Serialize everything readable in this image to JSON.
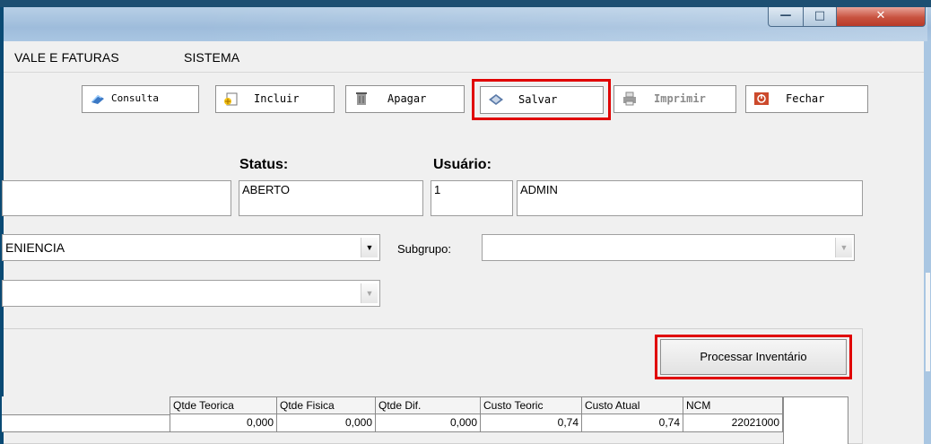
{
  "menu": {
    "items": [
      "VALE E FATURAS",
      "SISTEMA"
    ]
  },
  "toolbar": {
    "consulta": "Consulta",
    "incluir": "Incluir",
    "apagar": "Apagar",
    "salvar": "Salvar",
    "imprimir": "Imprimir",
    "fechar": "Fechar"
  },
  "header": {
    "status_label": "Status:",
    "status_value": "ABERTO",
    "usuario_label": "Usuário:",
    "usuario_id": "1",
    "usuario_name": "ADMIN"
  },
  "filters": {
    "grupo_value": "ENIENCIA",
    "subgrupo_label": "Subgrupo:",
    "subgrupo_value": "",
    "third_value": ""
  },
  "actions": {
    "process_label": "Processar Inventário"
  },
  "grid": {
    "columns": [
      "Qtde Teorica",
      "Qtde Fisica",
      "Qtde Dif.",
      "Custo Teoric",
      "Custo Atual",
      "NCM"
    ],
    "rows": [
      [
        "0,000",
        "0,000",
        "0,000",
        "0,74",
        "0,74",
        "22021000"
      ]
    ]
  },
  "colors": {
    "highlight": "#e00000",
    "titlebar": "#a9c6e2",
    "close": "#c8523f"
  }
}
